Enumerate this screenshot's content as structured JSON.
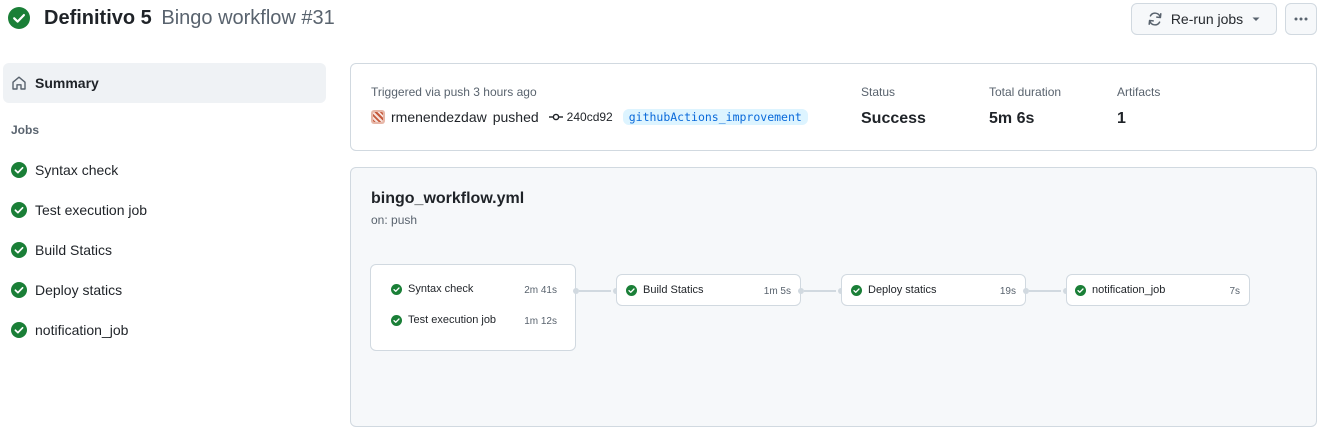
{
  "header": {
    "workflow_name": "Definitivo 5",
    "run_name": "Bingo workflow #31",
    "rerun_label": "Re-run jobs",
    "more_label": "More actions",
    "success_color": "#1a7f37"
  },
  "sidebar": {
    "summary_label": "Summary",
    "jobs_heading": "Jobs",
    "jobs": [
      {
        "label": "Syntax check"
      },
      {
        "label": "Test execution job"
      },
      {
        "label": "Build Statics"
      },
      {
        "label": "Deploy statics"
      },
      {
        "label": "notification_job"
      }
    ]
  },
  "summary": {
    "trigger": "Triggered via push 3 hours ago",
    "actor": "rmenendezdaw",
    "action": "pushed",
    "commit": "240cd92",
    "branch": "githubActions_improvement",
    "status_label": "Status",
    "status_value": "Success",
    "duration_label": "Total duration",
    "duration_value": "5m 6s",
    "artifacts_label": "Artifacts",
    "artifacts_value": "1"
  },
  "graph": {
    "file": "bingo_workflow.yml",
    "trigger": "on: push",
    "jobs": [
      {
        "label": "Syntax check",
        "duration": "2m 41s"
      },
      {
        "label": "Test execution job",
        "duration": "1m 12s"
      },
      {
        "label": "Build Statics",
        "duration": "1m 5s"
      },
      {
        "label": "Deploy statics",
        "duration": "19s"
      },
      {
        "label": "notification_job",
        "duration": "7s"
      }
    ]
  }
}
